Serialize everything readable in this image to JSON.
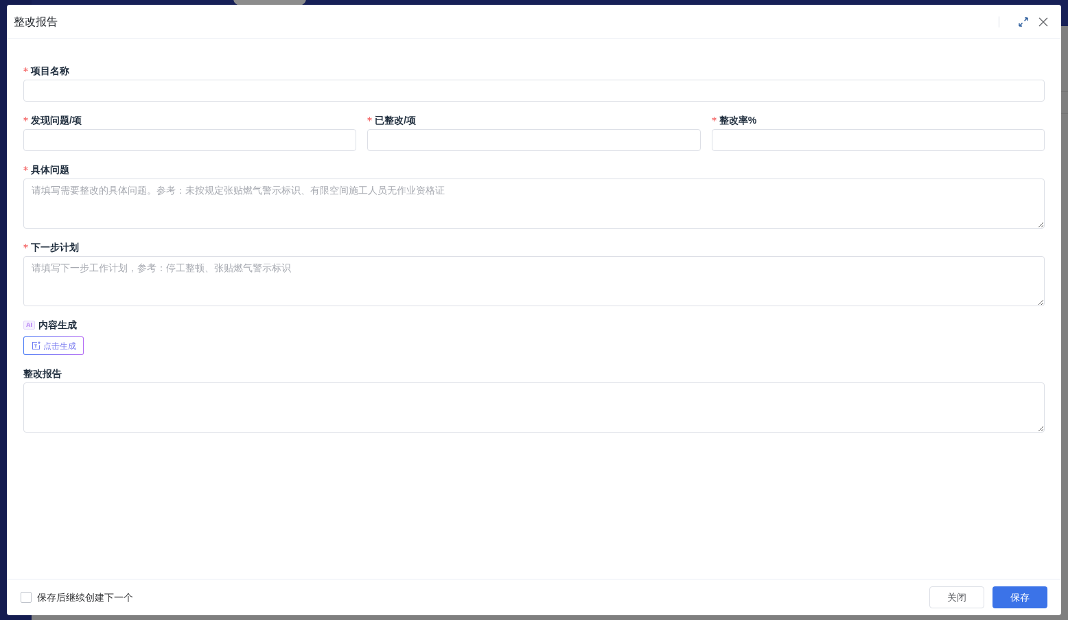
{
  "dialog": {
    "title": "整改报告"
  },
  "rows": [
    {
      "fields": [
        {
          "kind": "input",
          "label": "项目名称",
          "required": true
        }
      ]
    },
    {
      "fields": [
        {
          "kind": "input",
          "label": "发现问题/项",
          "required": true
        },
        {
          "kind": "input",
          "label": "已整改/项",
          "required": true
        },
        {
          "kind": "input",
          "label": "整改率%",
          "required": true
        }
      ]
    },
    {
      "fields": [
        {
          "kind": "textarea",
          "label": "具体问题",
          "required": true,
          "placeholder": "请填写需要整改的具体问题。参考：未按规定张贴燃气警示标识、有限空间施工人员无作业资格证"
        }
      ]
    },
    {
      "fields": [
        {
          "kind": "textarea",
          "label": "下一步计划",
          "required": true,
          "placeholder": "请填写下一步工作计划，参考：停工整顿、张贴燃气警示标识"
        }
      ]
    },
    {
      "fields": [
        {
          "kind": "ai",
          "badge": "AI",
          "label": "内容生成",
          "required": false,
          "button": "点击生成"
        }
      ]
    },
    {
      "fields": [
        {
          "kind": "textarea",
          "label": "整改报告",
          "required": false
        }
      ]
    }
  ],
  "footer": {
    "continue_checkbox": {
      "label": "保存后继续创建下一个",
      "checked": false
    },
    "buttons": [
      {
        "label": "关闭",
        "kind": "default"
      },
      {
        "label": "保存",
        "kind": "primary"
      }
    ]
  }
}
